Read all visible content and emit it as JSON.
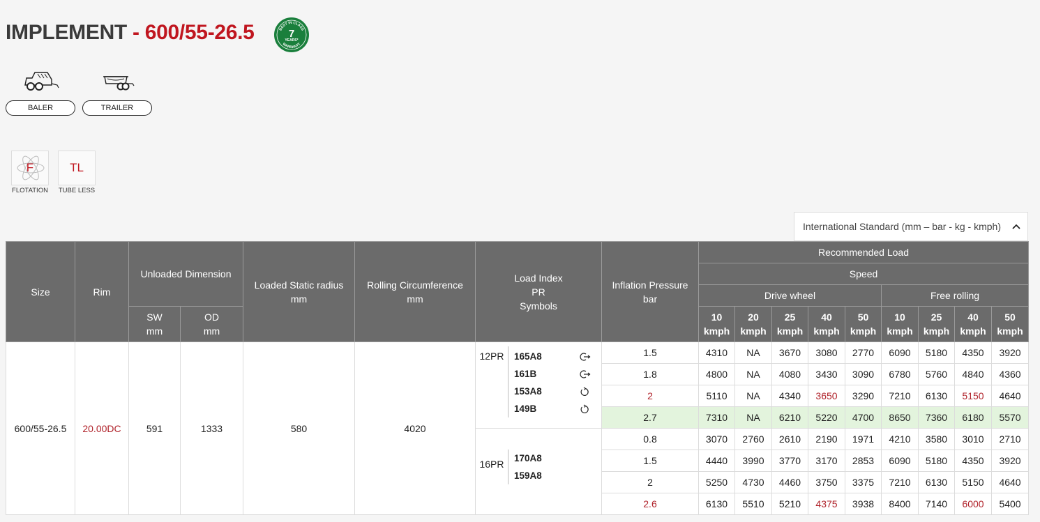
{
  "product": {
    "title_prefix": "IMPLEMENT",
    "title_separator": " - ",
    "title_size": "600/55-26.5",
    "warranty_badge": {
      "top_text": "BEST IN CLASS",
      "number": "7",
      "unit": "YEARS*",
      "bottom_text": "WARRANTY",
      "color": "#1a7f3c"
    }
  },
  "applications": [
    {
      "label": "BALER",
      "icon": "baler-icon"
    },
    {
      "label": "TRAILER",
      "icon": "trailer-icon"
    }
  ],
  "features": [
    {
      "label": "FLOTATION",
      "glyph": "F",
      "icon": "flotation-icon"
    },
    {
      "label": "TUBE LESS",
      "glyph": "TL",
      "icon": "tube-less-icon"
    }
  ],
  "unit_selector": {
    "value": "International Standard (mm – bar - kg - kmph)"
  },
  "colors": {
    "accent": "#c0161f",
    "header_bg": "#6b6b6b",
    "highlight_row": "#e3f4dd"
  },
  "table": {
    "headers": {
      "size": "Size",
      "rim": "Rim",
      "unloaded": "Unloaded Dimension",
      "sw": "SW",
      "sw_unit": "mm",
      "od": "OD",
      "od_unit": "mm",
      "loaded_radius": "Loaded Static radius",
      "loaded_radius_unit": "mm",
      "rolling": "Rolling Circumference",
      "rolling_unit": "mm",
      "load_index_1": "Load Index",
      "load_index_2": "PR",
      "load_index_3": "Symbols",
      "pressure": "Inflation Pressure",
      "pressure_unit": "bar",
      "recommended": "Recommended Load",
      "speed": "Speed",
      "drive": "Drive wheel",
      "free": "Free rolling",
      "kmph": "kmph",
      "drive_speeds": [
        "10",
        "20",
        "25",
        "40",
        "50"
      ],
      "free_speeds": [
        "10",
        "25",
        "40",
        "50"
      ]
    },
    "size": "600/55-26.5",
    "rim": "20.00DC",
    "sw": "591",
    "od": "1333",
    "loaded_radius": "580",
    "rolling": "4020",
    "load_index": [
      {
        "pr": "12PR",
        "codes": [
          {
            "code": "165A8",
            "symbol": "drive-wheel-symbol-icon"
          },
          {
            "code": "161B",
            "symbol": "drive-wheel-symbol-icon"
          },
          {
            "code": "153A8",
            "symbol": "free-rolling-symbol-icon"
          },
          {
            "code": "149B",
            "symbol": "free-rolling-symbol-icon"
          }
        ]
      },
      {
        "pr": "16PR",
        "codes": [
          {
            "code": "170A8",
            "symbol": ""
          },
          {
            "code": "159A8",
            "symbol": ""
          }
        ]
      }
    ],
    "rows": [
      {
        "pressure": "1.5",
        "drive": [
          "4310",
          "NA",
          "3670",
          "3080",
          "2770"
        ],
        "free": [
          "6090",
          "5180",
          "4350",
          "3920"
        ]
      },
      {
        "pressure": "1.8",
        "drive": [
          "4800",
          "NA",
          "4080",
          "3430",
          "3090"
        ],
        "free": [
          "6780",
          "5760",
          "4840",
          "4360"
        ]
      },
      {
        "pressure": "2",
        "drive": [
          "5110",
          "NA",
          "4340",
          "3650",
          "3290"
        ],
        "free": [
          "7210",
          "6130",
          "5150",
          "4640"
        ],
        "red_pressure": true,
        "red_drive": [
          3
        ],
        "red_free": [
          2
        ]
      },
      {
        "pressure": "2.7",
        "drive": [
          "7310",
          "NA",
          "6210",
          "5220",
          "4700"
        ],
        "free": [
          "8650",
          "7360",
          "6180",
          "5570"
        ],
        "highlight": true
      },
      {
        "pressure": "0.8",
        "drive": [
          "3070",
          "2760",
          "2610",
          "2190",
          "1971"
        ],
        "free": [
          "4210",
          "3580",
          "3010",
          "2710"
        ]
      },
      {
        "pressure": "1.5",
        "drive": [
          "4440",
          "3990",
          "3770",
          "3170",
          "2853"
        ],
        "free": [
          "6090",
          "5180",
          "4350",
          "3920"
        ]
      },
      {
        "pressure": "2",
        "drive": [
          "5250",
          "4730",
          "4460",
          "3750",
          "3375"
        ],
        "free": [
          "7210",
          "6130",
          "5150",
          "4640"
        ]
      },
      {
        "pressure": "2.6",
        "drive": [
          "6130",
          "5510",
          "5210",
          "4375",
          "3938"
        ],
        "free": [
          "8400",
          "7140",
          "6000",
          "5400"
        ],
        "red_pressure": true,
        "red_drive": [
          3
        ],
        "red_free": [
          2
        ]
      }
    ]
  }
}
